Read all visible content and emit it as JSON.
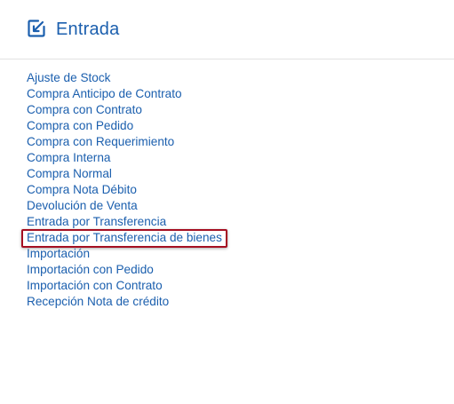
{
  "header": {
    "icon": "edit-arrow-in-icon",
    "title": "Entrada"
  },
  "colors": {
    "accent": "#1b5fae",
    "highlight_border": "#a50f22",
    "divider": "#e2e2e2"
  },
  "menu": {
    "items": [
      {
        "label": "Ajuste de Stock"
      },
      {
        "label": "Compra Anticipo de Contrato"
      },
      {
        "label": "Compra con Contrato"
      },
      {
        "label": "Compra con Pedido"
      },
      {
        "label": "Compra con Requerimiento"
      },
      {
        "label": "Compra Interna"
      },
      {
        "label": "Compra Normal"
      },
      {
        "label": "Compra Nota Débito"
      },
      {
        "label": "Devolución de Venta"
      },
      {
        "label": "Entrada por Transferencia"
      },
      {
        "label": "Entrada por Transferencia de bienes",
        "highlighted": true
      },
      {
        "label": "Importación"
      },
      {
        "label": "Importación con Pedido"
      },
      {
        "label": "Importación con Contrato"
      },
      {
        "label": "Recepción Nota de crédito"
      }
    ]
  }
}
